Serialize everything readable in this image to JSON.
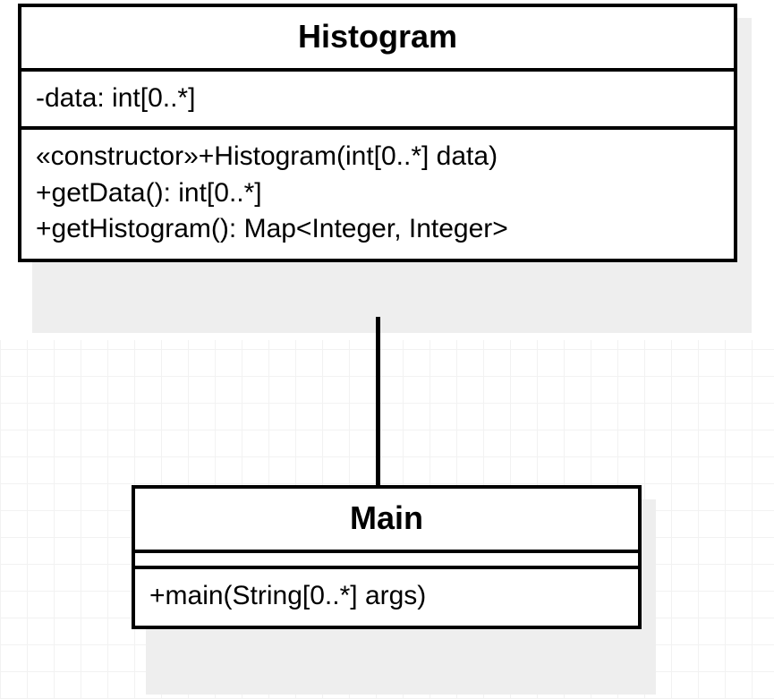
{
  "classes": {
    "histogram": {
      "name": "Histogram",
      "attributes": [
        "-data: int[0..*]"
      ],
      "methods": [
        "«constructor»+Histogram(int[0..*] data)",
        "+getData(): int[0..*]",
        "+getHistogram(): Map<Integer, Integer>"
      ]
    },
    "main": {
      "name": "Main",
      "attributes": [],
      "methods": [
        "+main(String[0..*] args)"
      ]
    }
  }
}
